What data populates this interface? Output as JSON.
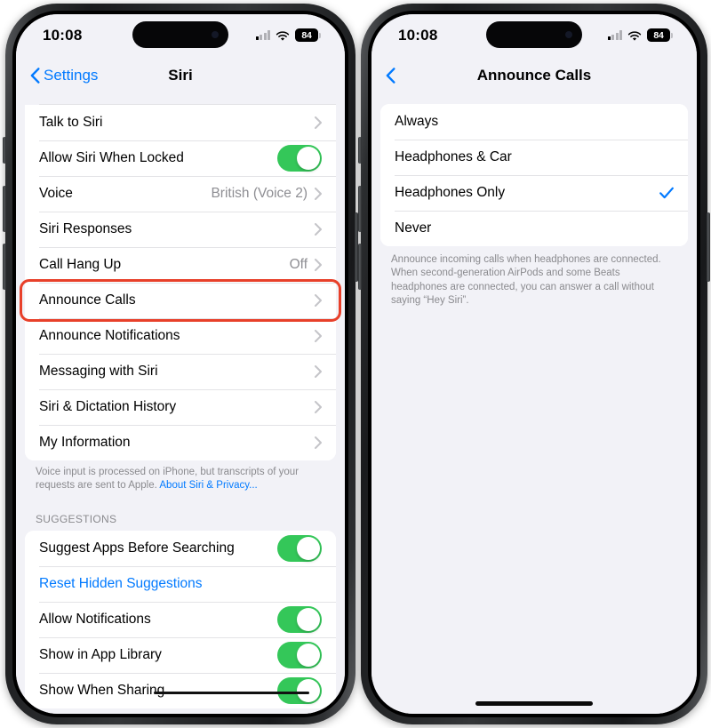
{
  "left_phone": {
    "status_bar": {
      "time": "10:08",
      "battery_level": "84",
      "signal_icon": "cellular-signal-icon",
      "wifi_icon": "wifi-icon"
    },
    "nav": {
      "back_label": "Settings",
      "title": "Siri",
      "back_icon": "chevron-left-icon"
    },
    "rows": [
      {
        "label": "Talk to Siri",
        "accessory": "chevron",
        "value": ""
      },
      {
        "label": "Allow Siri When Locked",
        "accessory": "toggle_on",
        "value": ""
      },
      {
        "label": "Voice",
        "accessory": "chevron",
        "value": "British (Voice 2)"
      },
      {
        "label": "Siri Responses",
        "accessory": "chevron",
        "value": ""
      },
      {
        "label": "Call Hang Up",
        "accessory": "chevron",
        "value": "Off"
      },
      {
        "label": "Announce Calls",
        "accessory": "chevron",
        "value": "",
        "highlighted": true
      },
      {
        "label": "Announce Notifications",
        "accessory": "chevron",
        "value": ""
      },
      {
        "label": "Messaging with Siri",
        "accessory": "chevron",
        "value": ""
      },
      {
        "label": "Siri & Dictation History",
        "accessory": "chevron",
        "value": ""
      },
      {
        "label": "My Information",
        "accessory": "chevron",
        "value": ""
      }
    ],
    "footnote": "Voice input is processed on iPhone, but transcripts of your requests are sent to Apple. ",
    "footnote_link": "About Siri & Privacy...",
    "suggestions_header": "SUGGESTIONS",
    "suggestion_rows": [
      {
        "label": "Suggest Apps Before Searching",
        "accessory": "toggle_on",
        "value": ""
      },
      {
        "label": "Reset Hidden Suggestions",
        "accessory": "none",
        "value": "",
        "link": true
      },
      {
        "label": "Allow Notifications",
        "accessory": "toggle_on",
        "value": ""
      },
      {
        "label": "Show in App Library",
        "accessory": "toggle_on",
        "value": ""
      },
      {
        "label": "Show When Sharing",
        "accessory": "toggle_on",
        "value": ""
      }
    ]
  },
  "right_phone": {
    "status_bar": {
      "time": "10:08",
      "battery_level": "84",
      "signal_icon": "cellular-signal-icon",
      "wifi_icon": "wifi-icon"
    },
    "nav": {
      "back_label": "",
      "title": "Announce Calls",
      "back_icon": "chevron-left-icon"
    },
    "options": [
      {
        "label": "Always",
        "selected": false
      },
      {
        "label": "Headphones & Car",
        "selected": false
      },
      {
        "label": "Headphones Only",
        "selected": true
      },
      {
        "label": "Never",
        "selected": false
      }
    ],
    "footnote": "Announce incoming calls when headphones are connected. When second-generation AirPods and some Beats headphones are connected, you can answer a call without saying “Hey Siri”."
  },
  "colors": {
    "accent_blue": "#027aff",
    "toggle_green": "#34c759",
    "highlight_red": "#e8402a",
    "group_bg": "#f2f2f7"
  }
}
